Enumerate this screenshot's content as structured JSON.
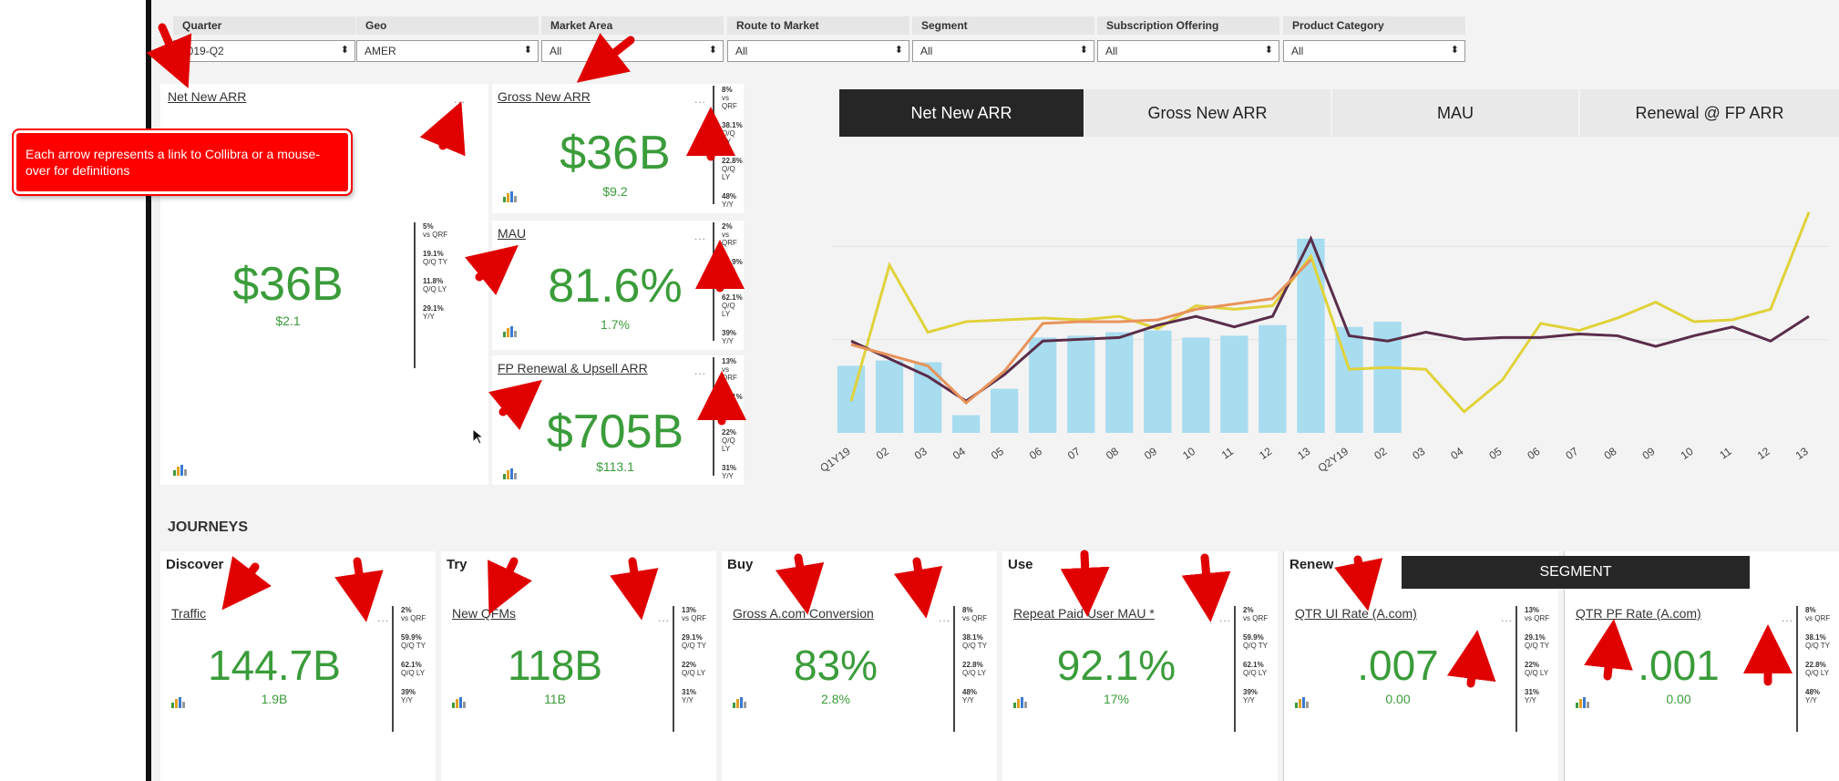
{
  "filters": [
    {
      "label": "Quarter",
      "value": "2019-Q2"
    },
    {
      "label": "Geo",
      "value": "AMER"
    },
    {
      "label": "Market Area",
      "value": "All"
    },
    {
      "label": "Route to Market",
      "value": "All"
    },
    {
      "label": "Segment",
      "value": "All"
    },
    {
      "label": "Subscription Offering",
      "value": "All"
    },
    {
      "label": "Product Category",
      "value": "All"
    }
  ],
  "callout": {
    "text": "Each arrow represents a link to Collibra or a mouse-over for definitions"
  },
  "kpis": {
    "net_new_arr": {
      "title": "Net New ARR",
      "value": "$36B",
      "sub": "$2.1",
      "stats": [
        {
          "v": "5%",
          "l": "vs QRF"
        },
        {
          "v": "19.1%",
          "l": "Q/Q TY"
        },
        {
          "v": "11.8%",
          "l": "Q/Q LY"
        },
        {
          "v": "29.1%",
          "l": "Y/Y"
        }
      ]
    },
    "gross_new_arr": {
      "title": "Gross New ARR",
      "value": "$36B",
      "sub": "$9.2",
      "stats": [
        {
          "v": "8%",
          "l": "vs QRF"
        },
        {
          "v": "38.1%",
          "l": "Q/Q TY"
        },
        {
          "v": "22.8%",
          "l": "Q/Q LY"
        },
        {
          "v": "48%",
          "l": "Y/Y"
        }
      ]
    },
    "mau": {
      "title": "MAU",
      "value": "81.6%",
      "sub": "1.7%",
      "stats": [
        {
          "v": "2%",
          "l": "vs QRF"
        },
        {
          "v": "59.9%",
          "l": "Q/Q TY"
        },
        {
          "v": "62.1%",
          "l": "Q/Q LY"
        },
        {
          "v": "39%",
          "l": "Y/Y"
        }
      ]
    },
    "fp_renewal": {
      "title": "FP Renewal & Upsell ARR",
      "value": "$705B",
      "sub": "$113.1",
      "stats": [
        {
          "v": "13%",
          "l": "vs QRF"
        },
        {
          "v": "29.1%",
          "l": "Q/Q TY"
        },
        {
          "v": "22%",
          "l": "Q/Q LY"
        },
        {
          "v": "31%",
          "l": "Y/Y"
        }
      ]
    }
  },
  "more_dots": "...",
  "tabs": [
    "Net New ARR",
    "Gross New ARR",
    "MAU",
    "Renewal @ FP ARR"
  ],
  "chart_data": {
    "type": "bar",
    "categories": [
      "Q1Y19",
      "02",
      "03",
      "04",
      "05",
      "06",
      "07",
      "08",
      "09",
      "10",
      "11",
      "12",
      "13",
      "Q2Y19",
      "02",
      "03",
      "04",
      "05",
      "06",
      "07",
      "08",
      "09",
      "10",
      "11",
      "12",
      "13"
    ],
    "series": [
      {
        "type": "bar",
        "color": "#a8dcef",
        "values": [
          38,
          41,
          40,
          10,
          25,
          54,
          55,
          57,
          58,
          54,
          55,
          61,
          110,
          60,
          63,
          null,
          null,
          null,
          null,
          null,
          null,
          null,
          null,
          null,
          null,
          null
        ]
      },
      {
        "type": "line",
        "color": "#e0d23a",
        "values": [
          18,
          95,
          57,
          63,
          64,
          65,
          64,
          66,
          59,
          72,
          70,
          72,
          100,
          36,
          37,
          36,
          12,
          30,
          62,
          58,
          65,
          74,
          63,
          64,
          70,
          125
        ]
      },
      {
        "type": "line",
        "color": "#5a2d4a",
        "values": [
          52,
          42,
          32,
          18,
          33,
          52,
          53,
          54,
          61,
          66,
          60,
          66,
          110,
          55,
          52,
          57,
          53,
          54,
          54,
          56,
          55,
          49,
          55,
          60,
          52,
          66
        ]
      },
      {
        "type": "line",
        "color": "#e8935a",
        "values": [
          50,
          44,
          38,
          17,
          35,
          62,
          63,
          63,
          64,
          70,
          73,
          76,
          98,
          null,
          null,
          null,
          null,
          null,
          null,
          null,
          null,
          null,
          null,
          null,
          null,
          null
        ]
      }
    ],
    "ylim": [
      0,
      160
    ]
  },
  "journeys": {
    "title": "JOURNEYS",
    "segment_label": "SEGMENT",
    "stages": [
      {
        "name": "Discover",
        "kpi": "Traffic",
        "value": "144.7B",
        "sub": "1.9B",
        "stats": [
          {
            "v": "2%",
            "l": "vs QRF"
          },
          {
            "v": "59.9%",
            "l": "Q/Q TY"
          },
          {
            "v": "62.1%",
            "l": "Q/Q LY"
          },
          {
            "v": "39%",
            "l": "Y/Y"
          }
        ]
      },
      {
        "name": "Try",
        "kpi": "New QFMs",
        "value": "118B",
        "sub": "11B",
        "stats": [
          {
            "v": "13%",
            "l": "vs QRF"
          },
          {
            "v": "29.1%",
            "l": "Q/Q TY"
          },
          {
            "v": "22%",
            "l": "Q/Q LY"
          },
          {
            "v": "31%",
            "l": "Y/Y"
          }
        ]
      },
      {
        "name": "Buy",
        "kpi": "Gross A.com Conversion",
        "value": "83%",
        "sub": "2.8%",
        "stats": [
          {
            "v": "8%",
            "l": "vs QRF"
          },
          {
            "v": "38.1%",
            "l": "Q/Q TY"
          },
          {
            "v": "22.8%",
            "l": "Q/Q LY"
          },
          {
            "v": "48%",
            "l": "Y/Y"
          }
        ]
      },
      {
        "name": "Use",
        "kpi": "Repeat Paid User MAU *",
        "value": "92.1%",
        "sub": "17%",
        "stats": [
          {
            "v": "2%",
            "l": "vs QRF"
          },
          {
            "v": "59.9%",
            "l": "Q/Q TY"
          },
          {
            "v": "62.1%",
            "l": "Q/Q LY"
          },
          {
            "v": "39%",
            "l": "Y/Y"
          }
        ]
      },
      {
        "name": "Renew",
        "kpi": "QTR UI Rate (A.com)",
        "value": ".007",
        "sub": "0.00",
        "stats": [
          {
            "v": "13%",
            "l": "vs QRF"
          },
          {
            "v": "29.1%",
            "l": "Q/Q TY"
          },
          {
            "v": "22%",
            "l": "Q/Q LY"
          },
          {
            "v": "31%",
            "l": "Y/Y"
          }
        ]
      },
      {
        "name": "",
        "kpi": "QTR PF Rate (A.com)",
        "value": ".001",
        "sub": "0.00",
        "stats": [
          {
            "v": "8%",
            "l": "vs QRF"
          },
          {
            "v": "38.1%",
            "l": "Q/Q TY"
          },
          {
            "v": "22.8%",
            "l": "Q/Q LY"
          },
          {
            "v": "48%",
            "l": "Y/Y"
          }
        ]
      }
    ]
  },
  "colors": {
    "accent_green": "#3a9c3a",
    "tab_active": "#262626",
    "arrow_red": "#e00000"
  }
}
